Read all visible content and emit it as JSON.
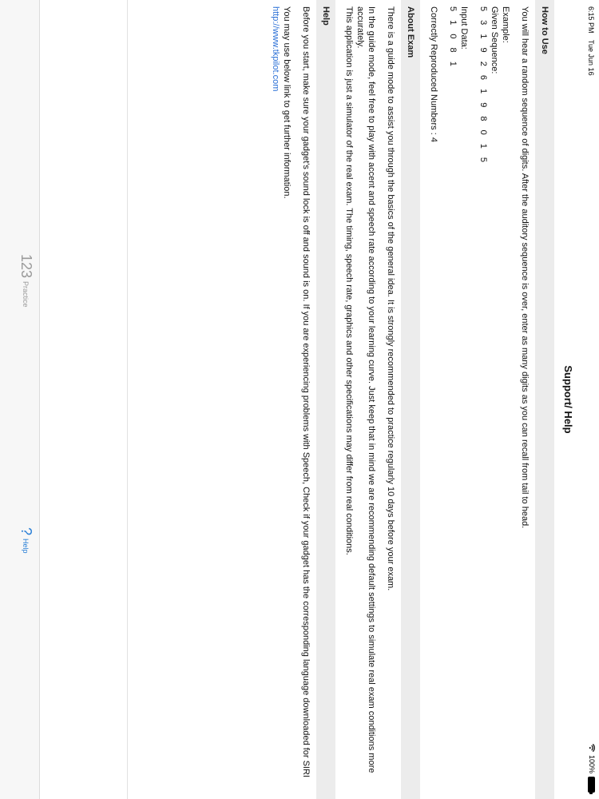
{
  "status": {
    "time": "6:15 PM",
    "date": "Tue Jun 16",
    "battery": "100%"
  },
  "nav": {
    "title": "Support/ Help"
  },
  "sections": {
    "how_to_use": {
      "title": "How to Use",
      "intro": "You will hear a random sequence of digits. After the auditory sequence is over, enter as many digits as you can recall from tail to head.",
      "example_label": "Example:",
      "given_label": "Given Sequence:",
      "given_digits": "5 3 1 9 2 6 1 9 8 0 1 5",
      "input_label": "Input Data:",
      "input_digits": "5 1 0 8 1",
      "correct": "Correctly Reproduced Numbers : 4"
    },
    "about_exam": {
      "title": "About Exam",
      "p1": "There is a guide mode to assist you through the basics of the general idea. It is strongly recommended to practice regularly 10 days before your exam.",
      "p2": "In the guide mode, feel free to play with accent and speech rate according to your learning curve. Just keep that in mind we are recommending default settings to simulate real exam conditions more accurately.",
      "p3": "This application is just a simulator of the real exam. The timing, speech rate, graphics and other specifications may differ from real conditions."
    },
    "help": {
      "title": "Help",
      "p1": "Before you start, make sure your gadget's sound lock is off and sound is on. If you are experiencing problems with Speech, Check if your gadget has the corresponding language downloaded for SIRI",
      "p2": "You may use below link to get further information.",
      "link": "http://www.tkpilot.com"
    }
  },
  "tabs": [
    {
      "icon": "123",
      "label": "Practice",
      "selected": false
    },
    {
      "icon": "?",
      "label": "Help",
      "selected": true
    }
  ],
  "colors": {
    "accent": "#2a7fd6",
    "section_header_bg": "#ececec",
    "inactive_tab": "#9a9a9a"
  }
}
